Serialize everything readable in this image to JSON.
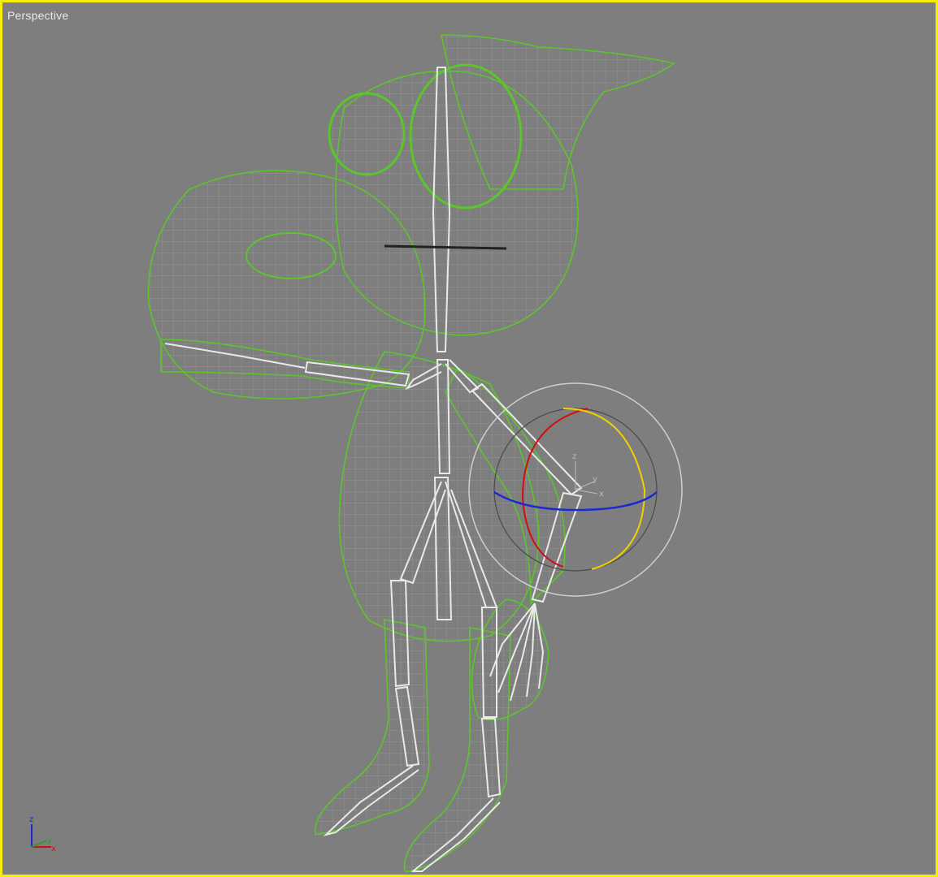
{
  "viewport": {
    "label": "Perspective",
    "active_border_color": "#f4f000",
    "background_color": "#7e7e7e"
  },
  "wireframe": {
    "mesh_color": "#5bc62a",
    "bone_color": "#e9e9e9"
  },
  "rotate_gizmo": {
    "x_color": "#d01010",
    "y_color": "#f0d000",
    "z_color": "#1a2ad0",
    "outer_ring_color": "#cfcfcf",
    "axis_labels": [
      "z",
      "y",
      "x"
    ]
  },
  "axis_tripod": {
    "labels": [
      "z",
      "y",
      "x"
    ]
  }
}
